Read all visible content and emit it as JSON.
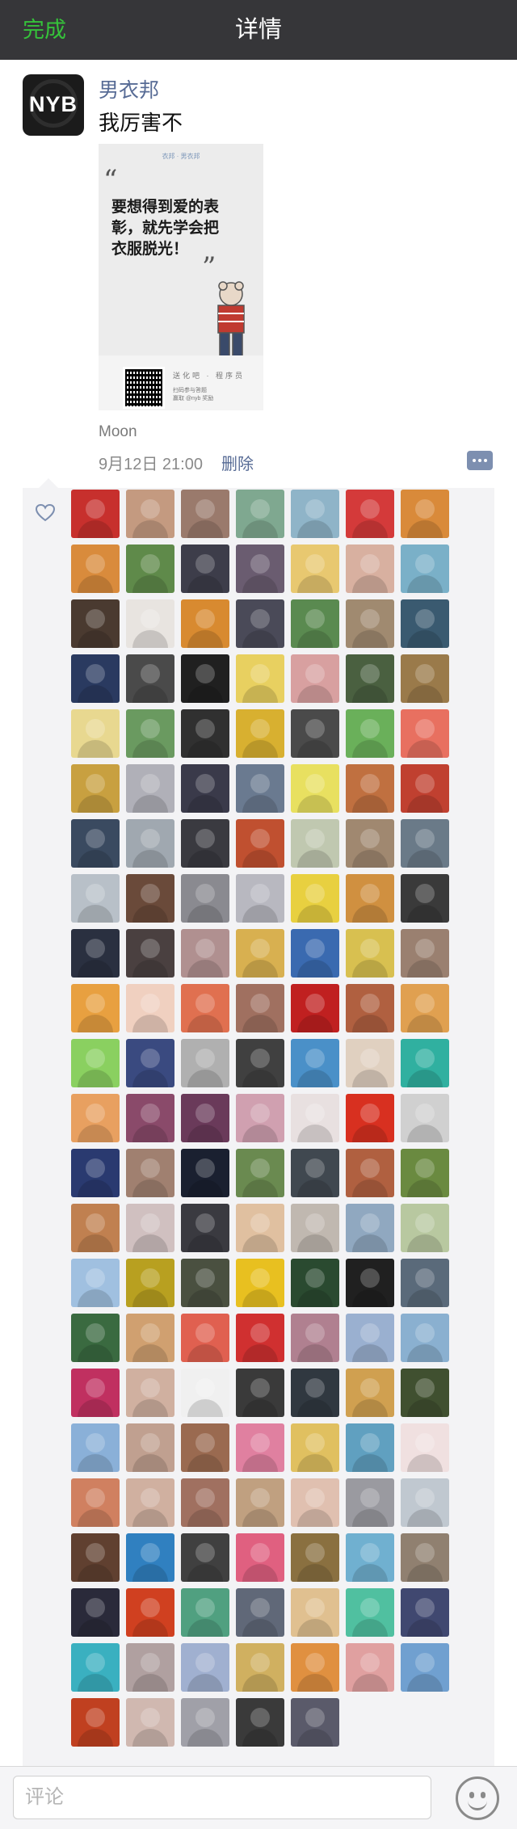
{
  "nav": {
    "done_label": "完成",
    "title": "详情"
  },
  "post": {
    "avatar_logo": "NYB",
    "author": "男衣邦",
    "text": "我厉害不",
    "image": {
      "header": "衣邦 · 男衣邦",
      "slogan": "要想得到爱的表彰，就先学会把衣服脱光！",
      "footer_line1": "送化吧 · 程序员",
      "footer_line2": "扫码参与答题",
      "footer_line3": "赢取 @nyb 奖励"
    },
    "location": "Moon",
    "timestamp": "9月12日 21:00",
    "delete_label": "删除"
  },
  "likes": {
    "icon": "heart-icon",
    "avatar_colors": [
      "#c7302d",
      "#c49a80",
      "#9a7a6c",
      "#7fa890",
      "#8fb4c8",
      "#d43a3a",
      "#d98a3a",
      "#d98b3c",
      "#5f8a4a",
      "#3d3d4a",
      "#6a5c70",
      "#e8c870",
      "#d8b0a0",
      "#7ab0c8",
      "#4a3a30",
      "#e8e4e0",
      "#d88a30",
      "#4a4a58",
      "#5a8a50",
      "#a08a70",
      "#3a5a70",
      "#2a3a60",
      "#4a4a4a",
      "#202020",
      "#e8d060",
      "#d8a0a0",
      "#4a6040",
      "#9a7a4a",
      "#e8d890",
      "#6a9a60",
      "#303030",
      "#d8b030",
      "#4a4a4a",
      "#6ab05a",
      "#e87060",
      "#c8a040",
      "#b0b0b8",
      "#3a3a4a",
      "#6a7a90",
      "#e8e060",
      "#c07040",
      "#c04030",
      "#3a4a60",
      "#a0a8b0",
      "#3a3a40",
      "#c05030",
      "#c0c8b0",
      "#a08870",
      "#6a7a88",
      "#b8c0c8",
      "#6a4a3a",
      "#8a8a90",
      "#b8b8c0",
      "#e8d040",
      "#d09040",
      "#3a3a3a",
      "#2a3040",
      "#4a4040",
      "#b09090",
      "#d8b050",
      "#3a6ab0",
      "#d8c050",
      "#9a8070",
      "#e8a040",
      "#f0d0c0",
      "#e07050",
      "#a07060",
      "#c02020",
      "#b06040",
      "#e0a050",
      "#8ad060",
      "#3a4a80",
      "#b0b0b0",
      "#404040",
      "#4a90c8",
      "#e0d0c0",
      "#30b0a0",
      "#e8a060",
      "#8a4a6a",
      "#6a3a5a",
      "#d0a0b0",
      "#e8e0e0",
      "#d83020",
      "#d0d0d0",
      "#2a3a70",
      "#a08070",
      "#1a2030",
      "#6a8a50",
      "#404850",
      "#b06040",
      "#6a8a40",
      "#c08050",
      "#d0c0c0",
      "#3a3a40",
      "#e0c0a0",
      "#c0b8b0",
      "#90a8c0",
      "#b8c8a0",
      "#a0c0e0",
      "#b8a020",
      "#4a5040",
      "#e8c020",
      "#2a4a30",
      "#202020",
      "#5a6a7a",
      "#3a6a40",
      "#d0a070",
      "#e06050",
      "#d03030",
      "#b08090",
      "#9ab0d0",
      "#8ab0d0",
      "#c03060",
      "#d0b0a0",
      "#f0f0f0",
      "#3a3a3a",
      "#303840",
      "#d0a050",
      "#405030",
      "#8ab0d8",
      "#c0a090",
      "#9a6a50",
      "#e080a0",
      "#e0c060",
      "#60a0c0",
      "#f0e0e0",
      "#d08060",
      "#d0b0a0",
      "#a07060",
      "#c0a080",
      "#e0c0b0",
      "#9a9aa0",
      "#c0c8d0",
      "#604030",
      "#3080c0",
      "#404040",
      "#e06080",
      "#8a7040",
      "#70b0d0",
      "#908070",
      "#2a2a3a",
      "#d04020",
      "#50a080",
      "#606878",
      "#e0c090",
      "#50c0a0",
      "#404870",
      "#3ab0c0",
      "#b0a0a0",
      "#a0b0d0",
      "#d0b060",
      "#e09040",
      "#e0a0a0",
      "#70a0d0",
      "#c04020",
      "#d0b8b0",
      "#a0a0a8",
      "#3a3a3a",
      "#5a5a6a"
    ]
  },
  "comment_bar": {
    "placeholder": "评论",
    "emoji_icon": "smiley-face-icon"
  }
}
